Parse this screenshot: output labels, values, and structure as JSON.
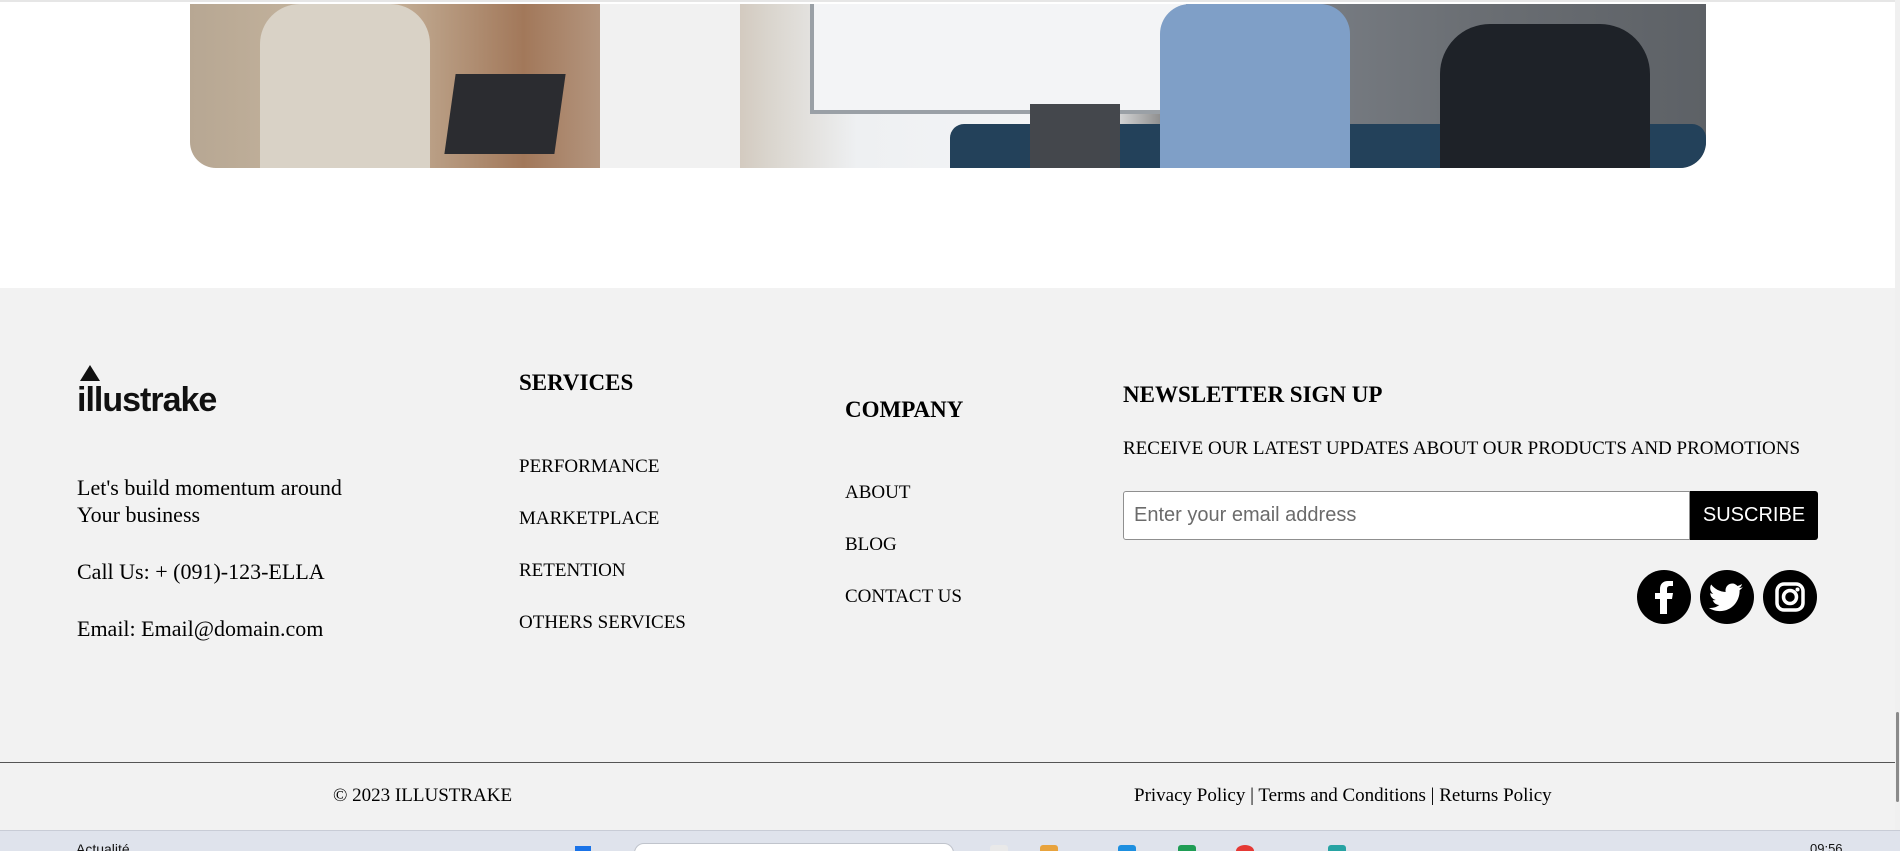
{
  "logo": {
    "text": "illustrake"
  },
  "about": {
    "tagline_line1": "Let's build momentum around",
    "tagline_line2": "Your business",
    "phone": "Call Us: + (091)-123-ELLA",
    "email": "Email: Email@domain.com"
  },
  "services": {
    "heading": "SERVICES",
    "items": [
      "PERFORMANCE",
      "MARKETPLACE",
      "RETENTION",
      "OTHERS SERVICES"
    ]
  },
  "company": {
    "heading": "COMPANY",
    "items": [
      "ABOUT",
      "BLOG",
      "CONTACT US"
    ]
  },
  "newsletter": {
    "heading": "NEWSLETTER SIGN UP",
    "description": "RECEIVE OUR LATEST UPDATES ABOUT OUR PRODUCTS AND PROMOTIONS",
    "placeholder": "Enter your email address",
    "button": "SUSCRIBE"
  },
  "social": {
    "icons": [
      "facebook-icon",
      "twitter-icon",
      "instagram-icon"
    ]
  },
  "bottom": {
    "copyright": "© 2023 ILLUSTRAKE",
    "privacy": "Privacy Policy",
    "terms": "Terms and Conditions",
    "returns": "Returns Policy",
    "separator": "|"
  },
  "taskbar": {
    "news": "Actualité",
    "time": "09:56"
  },
  "colors": {
    "footer_bg": "#f2f2f2",
    "button_bg": "#000000",
    "text": "#000000"
  }
}
